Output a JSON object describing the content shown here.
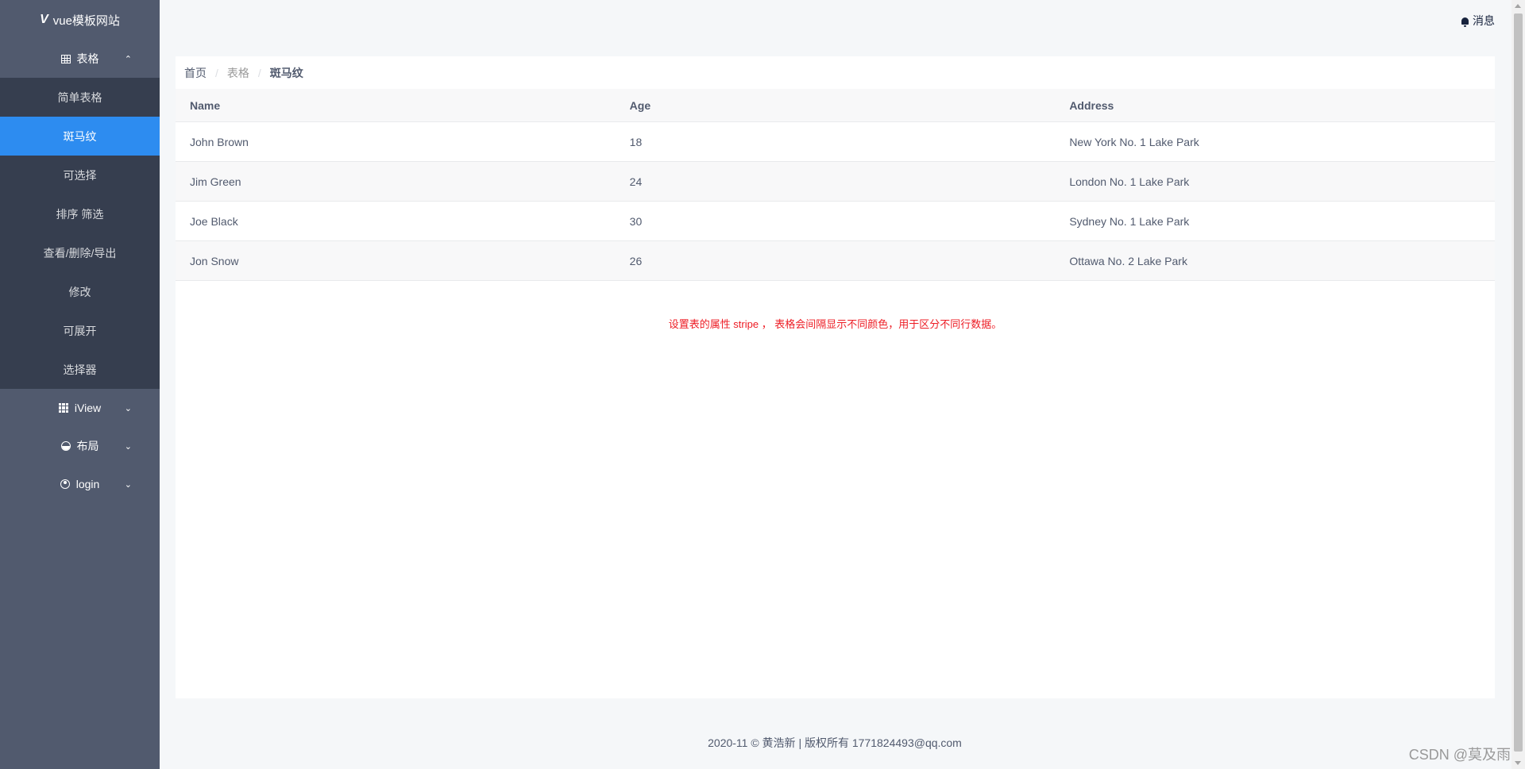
{
  "brand": {
    "logo": "V",
    "title": "vue模板网站"
  },
  "sidebar": {
    "group_table": {
      "label": "表格",
      "chevron": "⌃"
    },
    "table_items": [
      {
        "label": "简单表格"
      },
      {
        "label": "斑马纹"
      },
      {
        "label": "可选择"
      },
      {
        "label": "排序 筛选"
      },
      {
        "label": "查看/删除/导出"
      },
      {
        "label": "修改"
      },
      {
        "label": "可展开"
      },
      {
        "label": "选择器"
      }
    ],
    "active_index": 1,
    "group_iview": {
      "label": "iView",
      "chevron": "⌄"
    },
    "group_layout": {
      "label": "布局",
      "chevron": "⌄"
    },
    "group_login": {
      "label": "login",
      "chevron": "⌄"
    }
  },
  "header": {
    "message": "消息"
  },
  "breadcrumb": {
    "home": "首页",
    "section": "表格",
    "current": "斑马纹",
    "sep": "/"
  },
  "table": {
    "columns": [
      "Name",
      "Age",
      "Address"
    ],
    "rows": [
      [
        "John Brown",
        "18",
        "New York No. 1 Lake Park"
      ],
      [
        "Jim Green",
        "24",
        "London No. 1 Lake Park"
      ],
      [
        "Joe Black",
        "30",
        "Sydney No. 1 Lake Park"
      ],
      [
        "Jon Snow",
        "26",
        "Ottawa No. 2 Lake Park"
      ]
    ]
  },
  "note": "设置表的属性 stripe ， 表格会间隔显示不同颜色，用于区分不同行数据。",
  "footer": "2020-11 © 黄浩新 | 版权所有 1771824493@qq.com",
  "watermark": "CSDN @莫及雨",
  "colors": {
    "sidebar": "#515a6e",
    "submenu": "#363e4f",
    "active": "#2d8cf0",
    "note": "#ed1c24"
  }
}
